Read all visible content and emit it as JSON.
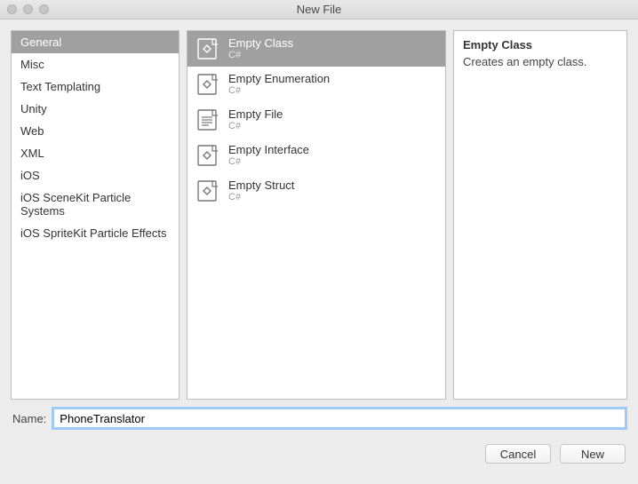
{
  "window": {
    "title": "New File"
  },
  "categories": [
    {
      "label": "General",
      "selected": true
    },
    {
      "label": "Misc",
      "selected": false
    },
    {
      "label": "Text Templating",
      "selected": false
    },
    {
      "label": "Unity",
      "selected": false
    },
    {
      "label": "Web",
      "selected": false
    },
    {
      "label": "XML",
      "selected": false
    },
    {
      "label": "iOS",
      "selected": false
    },
    {
      "label": "iOS SceneKit Particle Systems",
      "selected": false
    },
    {
      "label": "iOS SpriteKit Particle Effects",
      "selected": false
    }
  ],
  "templates": [
    {
      "title": "Empty Class",
      "lang": "C#",
      "icon": "diamond",
      "selected": true
    },
    {
      "title": "Empty Enumeration",
      "lang": "C#",
      "icon": "diamond",
      "selected": false
    },
    {
      "title": "Empty File",
      "lang": "C#",
      "icon": "lines",
      "selected": false
    },
    {
      "title": "Empty Interface",
      "lang": "C#",
      "icon": "diamond",
      "selected": false
    },
    {
      "title": "Empty Struct",
      "lang": "C#",
      "icon": "diamond",
      "selected": false
    }
  ],
  "description": {
    "title": "Empty Class",
    "body": "Creates an empty class."
  },
  "name": {
    "label": "Name:",
    "value": "PhoneTranslator"
  },
  "buttons": {
    "cancel": "Cancel",
    "new": "New"
  }
}
